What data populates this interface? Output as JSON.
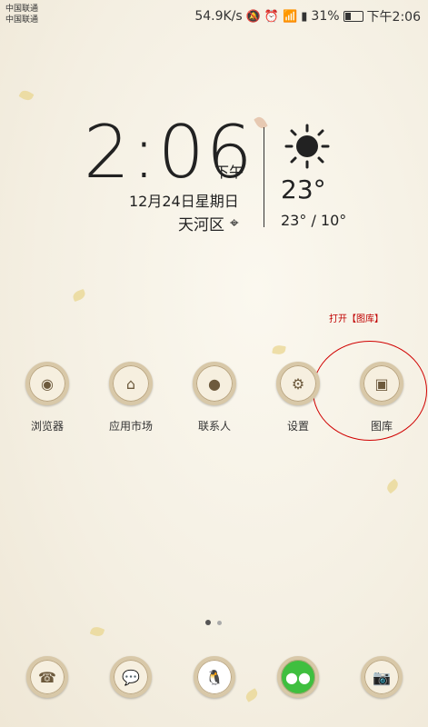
{
  "status_bar": {
    "carrier1": "中国联通",
    "carrier2": "中国联通",
    "network_speed": "54.9K/s",
    "battery": "31%",
    "time": "下午2:06"
  },
  "widget": {
    "clock": "2:06",
    "ampm": "下午",
    "date": "12月24日星期日",
    "location": "天河区",
    "temperature": "23°",
    "range": "23° / 10°"
  },
  "annotation": "打开【图库】",
  "apps": [
    {
      "label": "浏览器",
      "icon": "globe-icon"
    },
    {
      "label": "应用市场",
      "icon": "basket-icon"
    },
    {
      "label": "联系人",
      "icon": "contact-icon"
    },
    {
      "label": "设置",
      "icon": "gear-icon"
    },
    {
      "label": "图库",
      "icon": "gallery-icon"
    }
  ],
  "dock": [
    {
      "icon": "phone-icon"
    },
    {
      "icon": "message-icon"
    },
    {
      "icon": "qq-icon"
    },
    {
      "icon": "wechat-icon"
    },
    {
      "icon": "camera-icon"
    }
  ],
  "page_indicator": {
    "pages": 2,
    "current": 1
  }
}
